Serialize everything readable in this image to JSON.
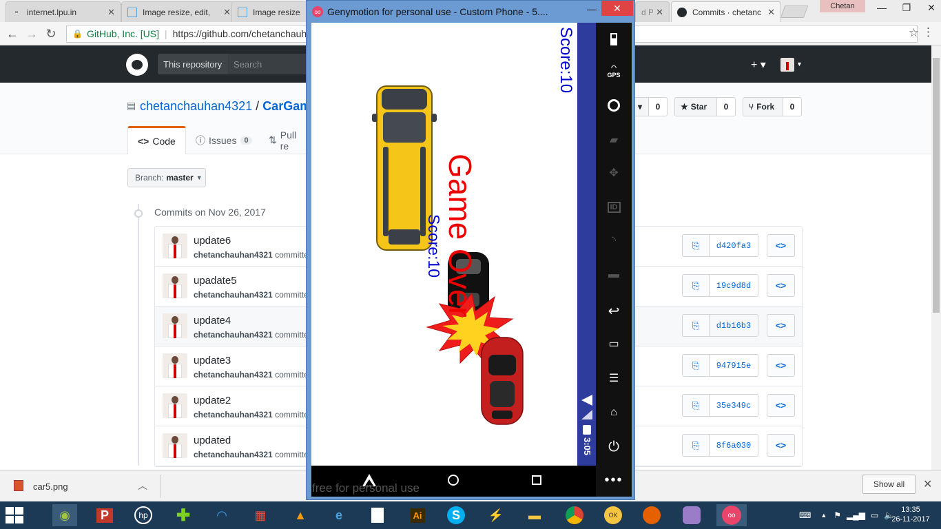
{
  "browser": {
    "tabs": [
      {
        "title": "internet.lpu.in",
        "icon": "page-icon"
      },
      {
        "title": "Image resize, edit,",
        "icon": "image-icon"
      },
      {
        "title": "Image resize, e",
        "icon": "image-icon"
      },
      {
        "title": "d Pr",
        "icon": "page-icon"
      },
      {
        "title": "Commits · chetanc",
        "icon": "github-icon"
      }
    ],
    "profile_name": "Chetan",
    "org_label": "GitHub, Inc. [US]",
    "url": "https://github.com/chetanchauha"
  },
  "github": {
    "scope_label": "This repository",
    "search_placeholder": "Search",
    "owner": "chetanchauhan4321",
    "repo": "CarGam",
    "watch_count": "0",
    "star_label": "Star",
    "star_count": "0",
    "fork_label": "Fork",
    "fork_count": "0",
    "tabs": {
      "code": "Code",
      "issues": "Issues",
      "issues_count": "0",
      "pulls": "Pull re"
    },
    "branch_label": "Branch:",
    "branch_name": "master",
    "commits_heading": "Commits on Nov 26, 2017",
    "commits": [
      {
        "title": "update6",
        "author": "chetanchauhan4321",
        "verb": "committe",
        "sha": "d420fa3"
      },
      {
        "title": "upadate5",
        "author": "chetanchauhan4321",
        "verb": "committe",
        "sha": "19c9d8d"
      },
      {
        "title": "update4",
        "author": "chetanchauhan4321",
        "verb": "committe",
        "sha": "d1b16b3"
      },
      {
        "title": "update3",
        "author": "chetanchauhan4321",
        "verb": "committe",
        "sha": "947915e"
      },
      {
        "title": "update2",
        "author": "chetanchauhan4321",
        "verb": "committe",
        "sha": "35e349c"
      },
      {
        "title": "updated",
        "author": "chetanchauhan4321",
        "verb": "committe",
        "sha": "8f6a030"
      }
    ]
  },
  "genymotion": {
    "window_title": "Genymotion for personal use - Custom Phone - 5....",
    "score_top": "Score:10",
    "score_mid": "Score:10",
    "game_over": "Game Over",
    "status_time": "3:05",
    "gps_label": "GPS",
    "id_label": "ID",
    "watermark": "free for personal use"
  },
  "downloads": {
    "file": "car5.png",
    "show_all": "Show all"
  },
  "taskbar": {
    "time": "13:35",
    "date": "26-11-2017"
  },
  "colors": {
    "github_dark": "#24292e",
    "link_blue": "#0366d6",
    "game_over_red": "#ee0000",
    "score_blue": "#0000cc",
    "android_status": "#2e3c9e"
  }
}
